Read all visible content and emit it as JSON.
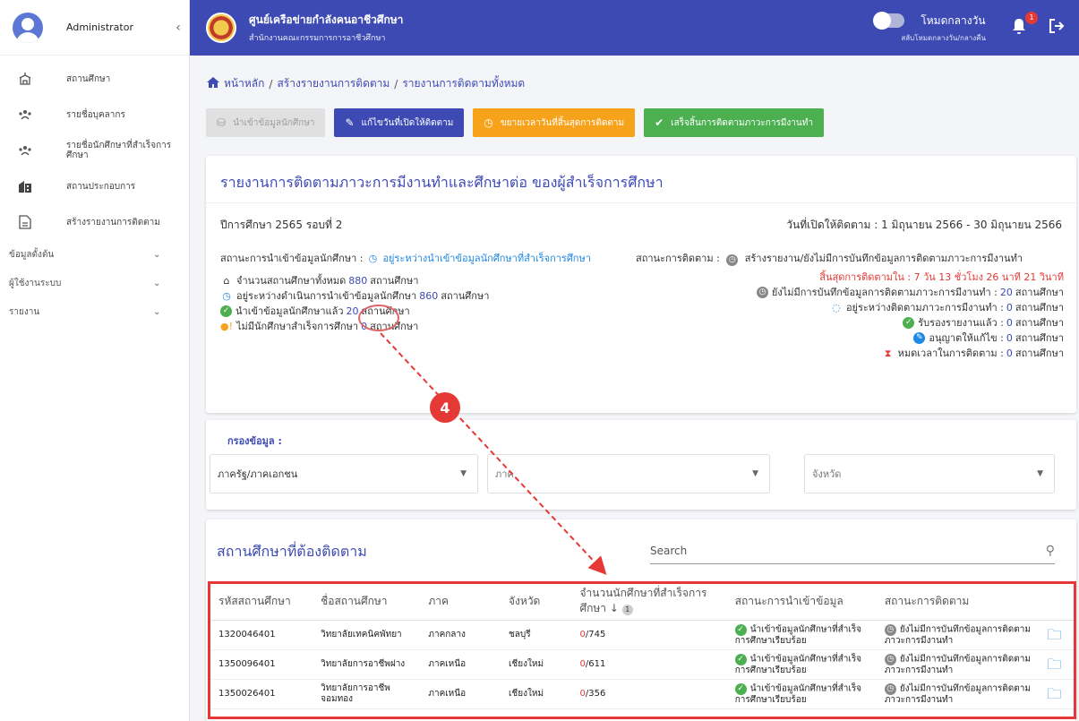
{
  "sidebar": {
    "user": "Administrator",
    "collapse_icon": "chevron-left-icon",
    "items": [
      {
        "label": "สถานศึกษา"
      },
      {
        "label": "รายชื่อบุคลากร"
      },
      {
        "label": "รายชื่อนักศึกษาที่สำเร็จการศึกษา"
      },
      {
        "label": "สถานประกอบการ"
      },
      {
        "label": "สร้างรายงานการติดตาม"
      }
    ],
    "groups": [
      {
        "label": "ข้อมูลตั้งต้น"
      },
      {
        "label": "ผู้ใช้งานระบบ"
      },
      {
        "label": "รายงาน"
      }
    ]
  },
  "header": {
    "title": "ศูนย์เครือข่ายกำลังคนอาชีวศึกษา",
    "subtitle": "สำนักงานคณะกรรมการการอาชีวศึกษา",
    "theme_label": "โหมดกลางวัน",
    "theme_sub": "สลับโหมดกลางวัน/กลางคืน",
    "notifications": "1"
  },
  "breadcrumb": {
    "home": "หน้าหลัก",
    "step2": "สร้างรายงานการติดตาม",
    "current": "รายงานการติดตามทั้งหมด"
  },
  "buttons": {
    "import": "นำเข้าข้อมูลนักศึกษา",
    "edit_date": "แก้ไขวันที่เปิดให้ติดตาม",
    "extend": "ขยายเวลาวันที่สิ้นสุดการติดตาม",
    "finish": "เสร็จสิ้นการติดตามภาวะการมีงานทำ"
  },
  "report": {
    "title": "รายงานการติดตามภาวะการมีงานทำและศึกษาต่อ ของผู้สำเร็จการศึกษา",
    "year": "ปีการศึกษา 2565 รอบที่ 2",
    "opened": "วันที่เปิดให้ติดตาม : 1 มิถุนายน 2566 - 30 มิถุนายน 2566",
    "import_status_label": "สถานะการนำเข้าข้อมูลนักศึกษา :",
    "import_status_value": "อยู่ระหว่างนำเข้าข้อมูลนักศึกษาที่สำเร็จการศึกษา",
    "total_label": "จำนวนสถานศึกษาทั้งหมด",
    "total_num": "880",
    "in_progress_label": "อยู่ระหว่างดำเนินการนำเข้าข้อมูลนักศึกษา",
    "in_progress_num": "860",
    "imported_label": "นำเข้าข้อมูลนักศึกษาแล้ว",
    "imported_num": "20",
    "no_grad_label": "ไม่มีนักศึกษาสำเร็จการศึกษา",
    "no_grad_num": "0",
    "unit": "สถานศึกษา",
    "follow_status_label": "สถานะการติดตาม :",
    "follow_status_value": "สร้างรายงาน/ยังไม่มีการบันทึกข้อมูลการติดตามภาวะการมีงานทำ",
    "countdown": "สิ้นสุดการติดตามใน : 7 วัน 13 ชั่วโมง 26 นาที 21 วินาที",
    "not_recorded_label": "ยังไม่มีการบันทึกข้อมูลการติดตามภาวะการมีงานทำ :",
    "not_recorded_num": "20",
    "following_label": "อยู่ระหว่างติดตามภาวะการมีงานทำ :",
    "following_num": "0",
    "approved_label": "รับรองรายงานแล้ว :",
    "approved_num": "0",
    "allow_edit_label": "อนุญาตให้แก้ไข :",
    "allow_edit_num": "0",
    "timeout_label": "หมดเวลาในการติดตาม :",
    "timeout_num": "0"
  },
  "filter": {
    "title": "กรองข้อมูล :",
    "sector": "ภาครัฐ/ภาคเอกชน",
    "region": "ภาค",
    "province": "จังหวัด"
  },
  "list": {
    "title": "สถานศึกษาที่ต้องติดตาม",
    "search_placeholder": "Search",
    "columns": {
      "code": "รหัสสถานศึกษา",
      "name": "ชื่อสถานศึกษา",
      "region": "ภาค",
      "province": "จังหวัด",
      "count": "จำนวนนักศึกษาที่สำเร็จการศึกษา",
      "sort_badge": "1",
      "import": "สถานะการนำเข้าข้อมูล",
      "follow": "สถานะการติดตาม"
    },
    "rows": [
      {
        "code": "1320046401",
        "name": "วิทยาลัยเทคนิคพัทยา",
        "region": "ภาคกลาง",
        "province": "ชลบุรี",
        "done": "0",
        "total": "/745",
        "import": "นำเข้าข้อมูลนักศึกษาที่สำเร็จการศึกษาเรียบร้อย",
        "follow": "ยังไม่มีการบันทึกข้อมูลการติดตามภาวะการมีงานทำ"
      },
      {
        "code": "1350096401",
        "name": "วิทยาลัยการอาชีพฝาง",
        "region": "ภาคเหนือ",
        "province": "เชียงใหม่",
        "done": "0",
        "total": "/611",
        "import": "นำเข้าข้อมูลนักศึกษาที่สำเร็จการศึกษาเรียบร้อย",
        "follow": "ยังไม่มีการบันทึกข้อมูลการติดตามภาวะการมีงานทำ"
      },
      {
        "code": "1350026401",
        "name": "วิทยาลัยการอาชีพจอมทอง",
        "region": "ภาคเหนือ",
        "province": "เชียงใหม่",
        "done": "0",
        "total": "/356",
        "import": "นำเข้าข้อมูลนักศึกษาที่สำเร็จการศึกษาเรียบร้อย",
        "follow": "ยังไม่มีการบันทึกข้อมูลการติดตามภาวะการมีงานทำ"
      }
    ]
  },
  "annotation": {
    "step": "4"
  }
}
